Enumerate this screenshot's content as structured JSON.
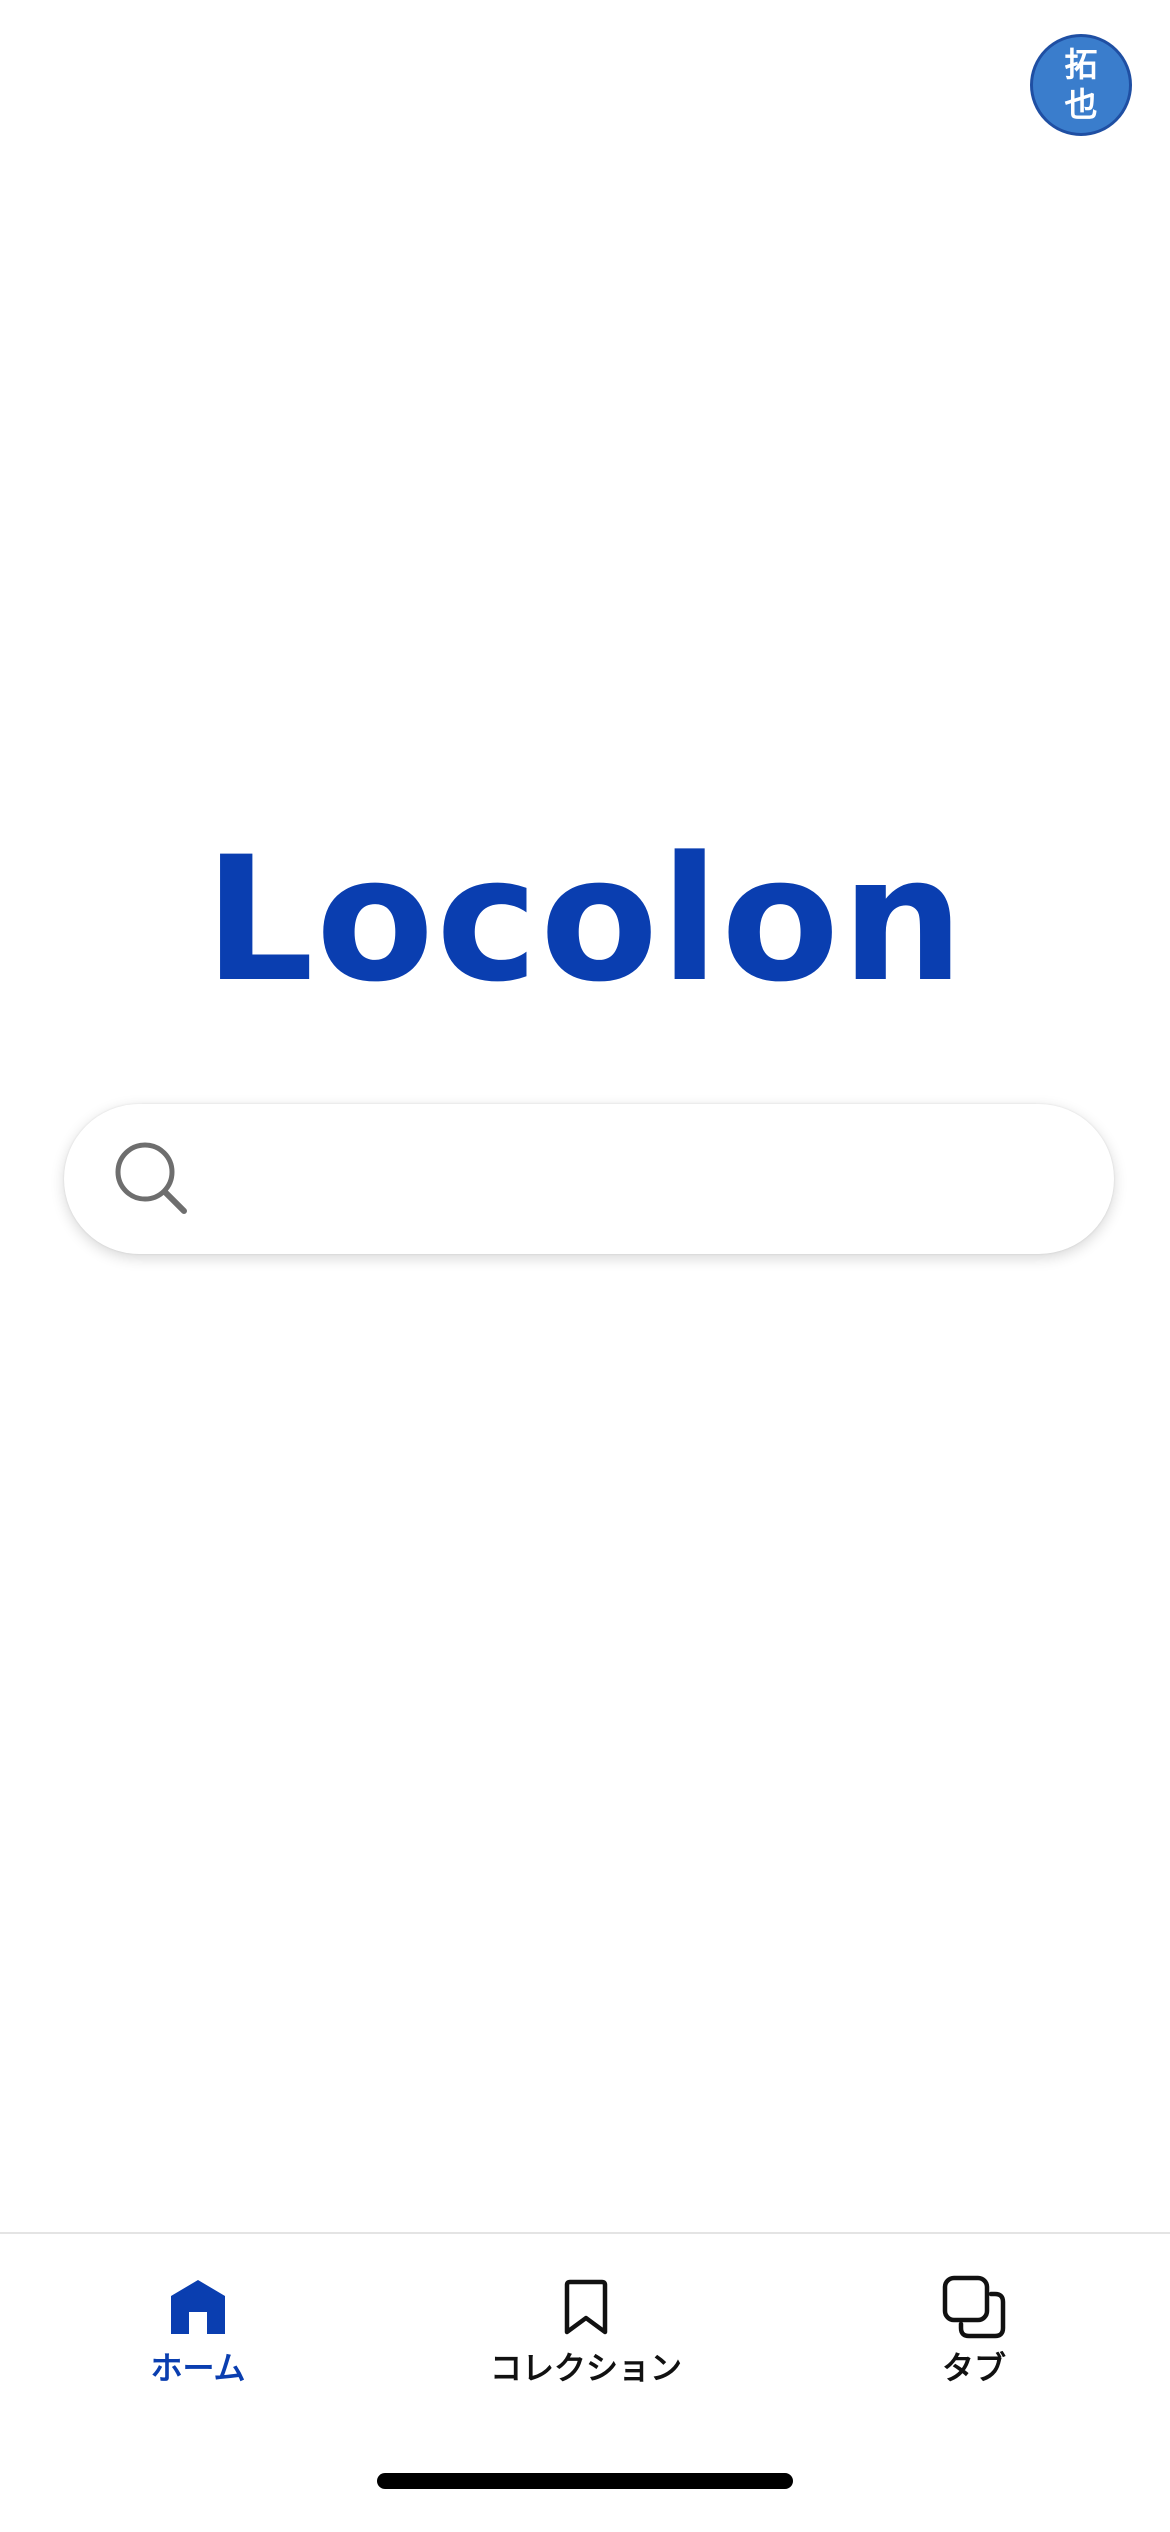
{
  "header": {
    "avatar_text": "拓也"
  },
  "main": {
    "logo_text": "Locolon",
    "search": {
      "value": "",
      "placeholder": "",
      "icon": "search-icon"
    }
  },
  "tab_bar": {
    "items": [
      {
        "label": "ホーム",
        "icon": "home-icon",
        "active": true
      },
      {
        "label": "コレクション",
        "icon": "bookmark-icon",
        "active": false
      },
      {
        "label": "タブ",
        "icon": "tabs-icon",
        "active": false
      }
    ]
  },
  "colors": {
    "brand": "#0a3eb0",
    "avatar_bg": "#3a7dcc",
    "icon_gray": "#6e6e6e",
    "text_dark": "#111111"
  }
}
